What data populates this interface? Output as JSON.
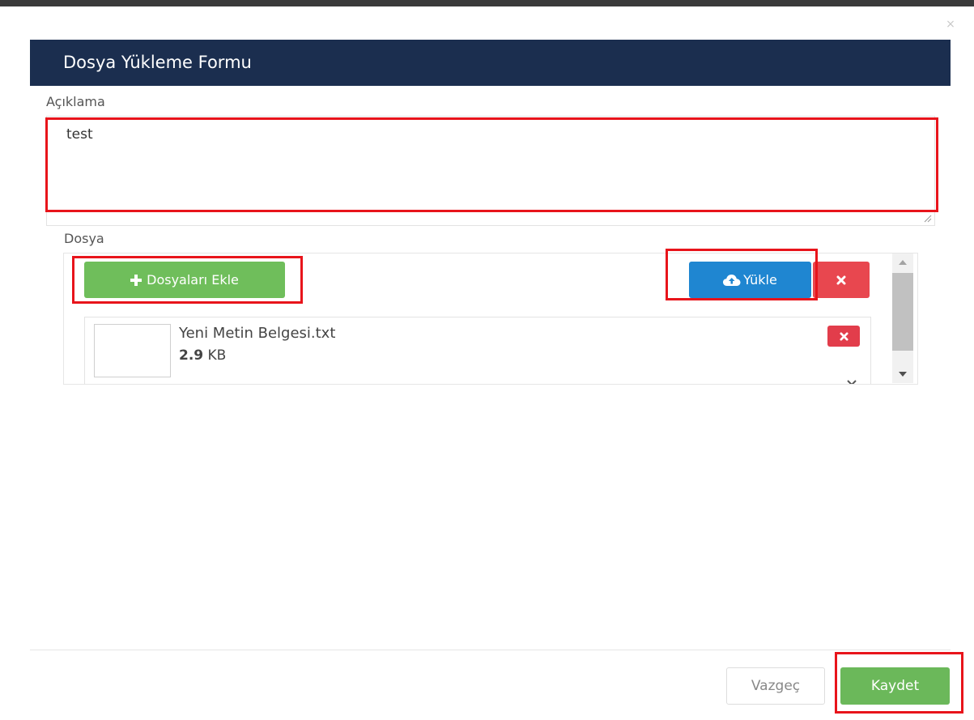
{
  "dialog": {
    "close_label": "×",
    "title": "Dosya Yükleme Formu"
  },
  "description": {
    "label": "Açıklama",
    "value": "test"
  },
  "file_section": {
    "label": "Dosya",
    "add_files_label": "Dosyaları Ekle",
    "upload_label": "Yükle",
    "add_icon": "plus-icon",
    "upload_icon": "cloud-upload-icon",
    "cancel_icon": "close-icon"
  },
  "files": [
    {
      "name": "Yeni Metin Belgesi.txt",
      "size_value": "2.9",
      "size_unit": "KB"
    }
  ],
  "footer": {
    "cancel_label": "Vazgeç",
    "save_label": "Kaydet"
  },
  "colors": {
    "header_bg": "#1b2e4f",
    "add_button": "#6fbe5b",
    "upload_button": "#1f86d1",
    "danger_button": "#e8474f",
    "save_button": "#6bb85a",
    "annotation": "#e8141b"
  }
}
